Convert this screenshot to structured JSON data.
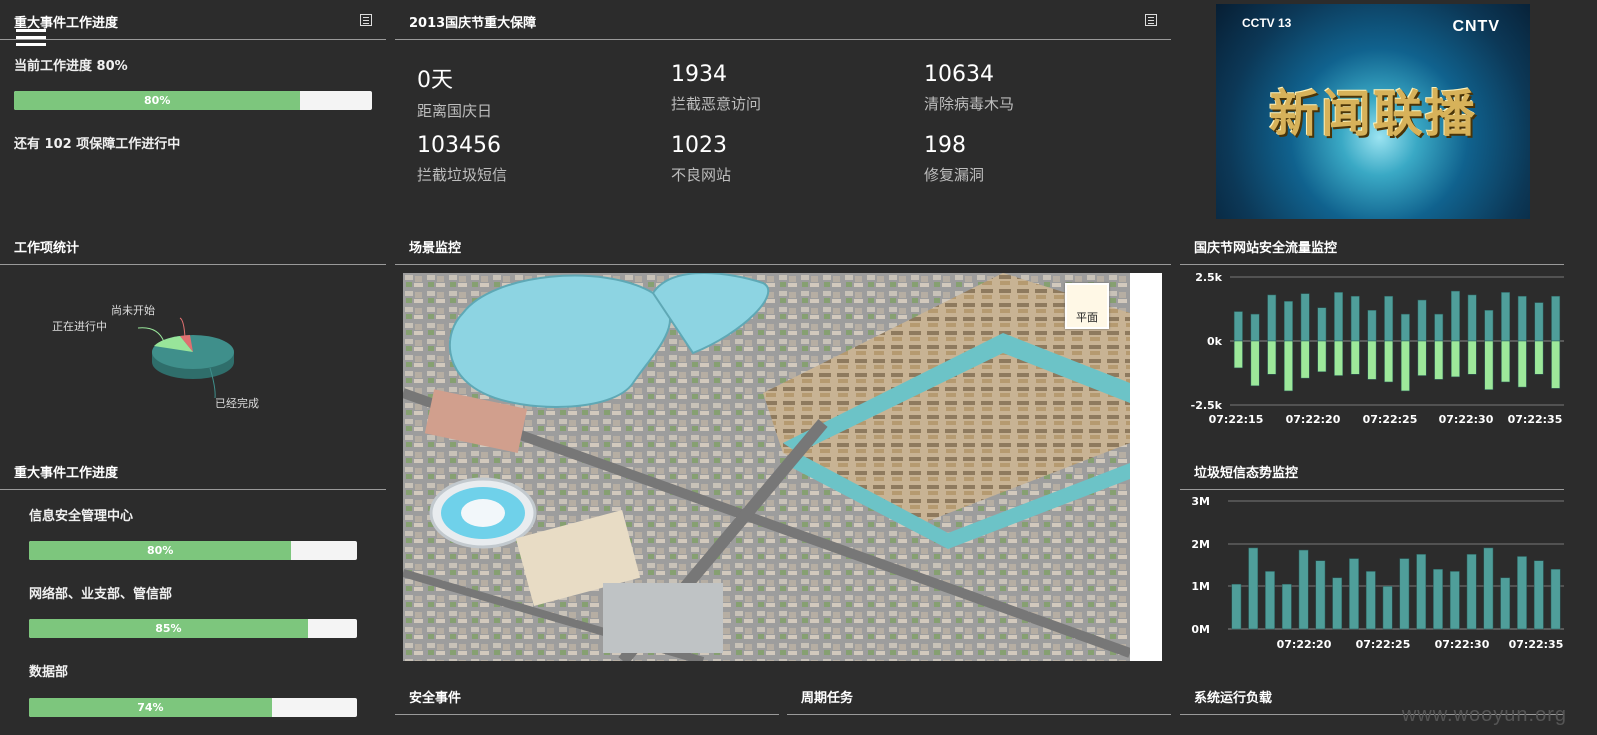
{
  "panels": {
    "major_progress": "重大事件工作进度",
    "holiday": "2013国庆节重大保障",
    "work_stats": "工作项统计",
    "scene": "场景监控",
    "traffic": "国庆节网站安全流量监控",
    "major_progress2": "重大事件工作进度",
    "spam": "垃圾短信态势监控",
    "security_events": "安全事件",
    "periodic_tasks": "周期任务",
    "system_load": "系统运行负载"
  },
  "progress_top": {
    "current_label": "当前工作进度 80%",
    "value": 80,
    "value_label": "80%",
    "remaining": "还有 102 项保障工作进行中"
  },
  "stats": [
    {
      "num": "0天",
      "label": "距离国庆日"
    },
    {
      "num": "1934",
      "label": "拦截恶意访问"
    },
    {
      "num": "10634",
      "label": "清除病毒木马"
    },
    {
      "num": "103456",
      "label": "拦截垃圾短信"
    },
    {
      "num": "1023",
      "label": "不良网站"
    },
    {
      "num": "198",
      "label": "修复漏洞"
    }
  ],
  "news": {
    "logo_left": "CCTV 13",
    "logo_right": "CNTV",
    "title": "新闻联播"
  },
  "map": {
    "button_label": "平面"
  },
  "dept_progress": [
    {
      "name": "信息安全管理中心",
      "value": 80,
      "label": "80%"
    },
    {
      "name": "网络部、业支部、管信部",
      "value": 85,
      "label": "85%"
    },
    {
      "name": "数据部",
      "value": 74,
      "label": "74%"
    }
  ],
  "colors": {
    "progress_fill": "#7dc67d",
    "bar_teal": "#4f9e9a",
    "bar_green": "#9de89a",
    "pie_teal": "#3f8f8b",
    "pie_green": "#98e59a",
    "pie_red": "#e07070"
  },
  "chart_data": [
    {
      "type": "pie",
      "labels": [
        "尚未开始",
        "正在进行中",
        "已经完成"
      ],
      "values": [
        4,
        12,
        84
      ]
    },
    {
      "type": "bar",
      "x_tick_labels": [
        "07:22:15",
        "07:22:20",
        "07:22:25",
        "07:22:30",
        "07:22:35"
      ],
      "y_tick_labels": [
        "2.5k",
        "0k",
        "-2.5k"
      ],
      "ylim": [
        -2500,
        2500
      ],
      "series": [
        {
          "values": [
            1150,
            1050,
            1800,
            1550,
            1850,
            1300,
            1900,
            1750,
            1200,
            1750,
            1050,
            1600,
            1050,
            1950,
            1800,
            1200,
            1900,
            1750,
            1500,
            1750
          ]
        },
        {
          "values": [
            -1050,
            -1750,
            -1300,
            -1950,
            -1450,
            -1200,
            -1350,
            -1300,
            -1500,
            -1600,
            -1950,
            -1350,
            -1500,
            -1400,
            -1300,
            -1900,
            -1600,
            -1800,
            -1300,
            -1850
          ]
        }
      ]
    },
    {
      "type": "bar",
      "x_tick_labels": [
        "07:22:20",
        "07:22:25",
        "07:22:30",
        "07:22:35"
      ],
      "y_tick_labels": [
        "3M",
        "2M",
        "1M",
        "0M"
      ],
      "ylim": [
        0,
        3000000
      ],
      "series": [
        {
          "values": [
            1050000,
            1900000,
            1350000,
            1050000,
            1850000,
            1600000,
            1200000,
            1650000,
            1350000,
            1000000,
            1650000,
            1750000,
            1400000,
            1350000,
            1750000,
            1900000,
            1200000,
            1700000,
            1600000,
            1400000
          ]
        }
      ]
    }
  ],
  "watermark": "www.wooyun.org"
}
